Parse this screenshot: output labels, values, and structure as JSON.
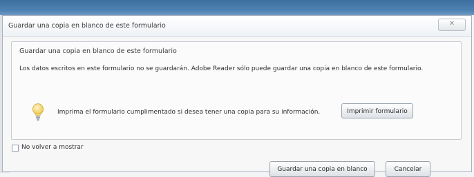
{
  "dialog": {
    "title": "Guardar una copia en blanco de este formulario",
    "close_symbol": "✕"
  },
  "group": {
    "title": "Guardar una copia en blanco de este formulario",
    "description": "Los datos escritos en este formulario no se guardarán. Adobe Reader sólo puede guardar una copia en blanco de este formulario."
  },
  "info": {
    "icon": "lightbulb-icon",
    "text": "Imprima el formulario cumplimentado si desea tener una copia para su información.",
    "print_button": "Imprimir formulario"
  },
  "options": {
    "dont_show_again": "No volver a mostrar",
    "checked": false
  },
  "footer": {
    "save_button": "Guardar una copia en blanco",
    "cancel_button": "Cancelar"
  },
  "colors": {
    "top_band": "#4f82b2",
    "dialog_bg": "#f7f7f7",
    "bulb": "#f2d36b"
  }
}
